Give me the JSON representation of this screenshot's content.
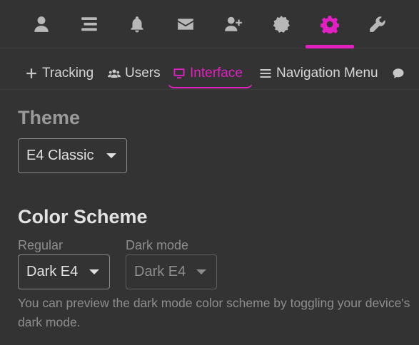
{
  "topnav": {
    "icons": [
      "user-icon",
      "list-icon",
      "bell-icon",
      "envelope-icon",
      "user-plus-icon",
      "badge-icon",
      "gear-icon",
      "wrench-icon"
    ],
    "active": "gear-icon",
    "accent_color": "#e020c0"
  },
  "subnav": {
    "tabs": [
      {
        "label": "Tracking",
        "icon": "plus-icon"
      },
      {
        "label": "Users",
        "icon": "users-icon"
      },
      {
        "label": "Interface",
        "icon": "monitor-icon",
        "active": true
      },
      {
        "label": "Navigation Menu",
        "icon": "bars-icon"
      }
    ]
  },
  "theme": {
    "heading": "Theme",
    "selected": "E4 Classic"
  },
  "color_scheme": {
    "heading": "Color Scheme",
    "regular_label": "Regular",
    "regular_value": "Dark E4",
    "dark_label": "Dark mode",
    "dark_value": "Dark E4",
    "help": "You can preview the dark mode color scheme by toggling your device's dark mode."
  }
}
